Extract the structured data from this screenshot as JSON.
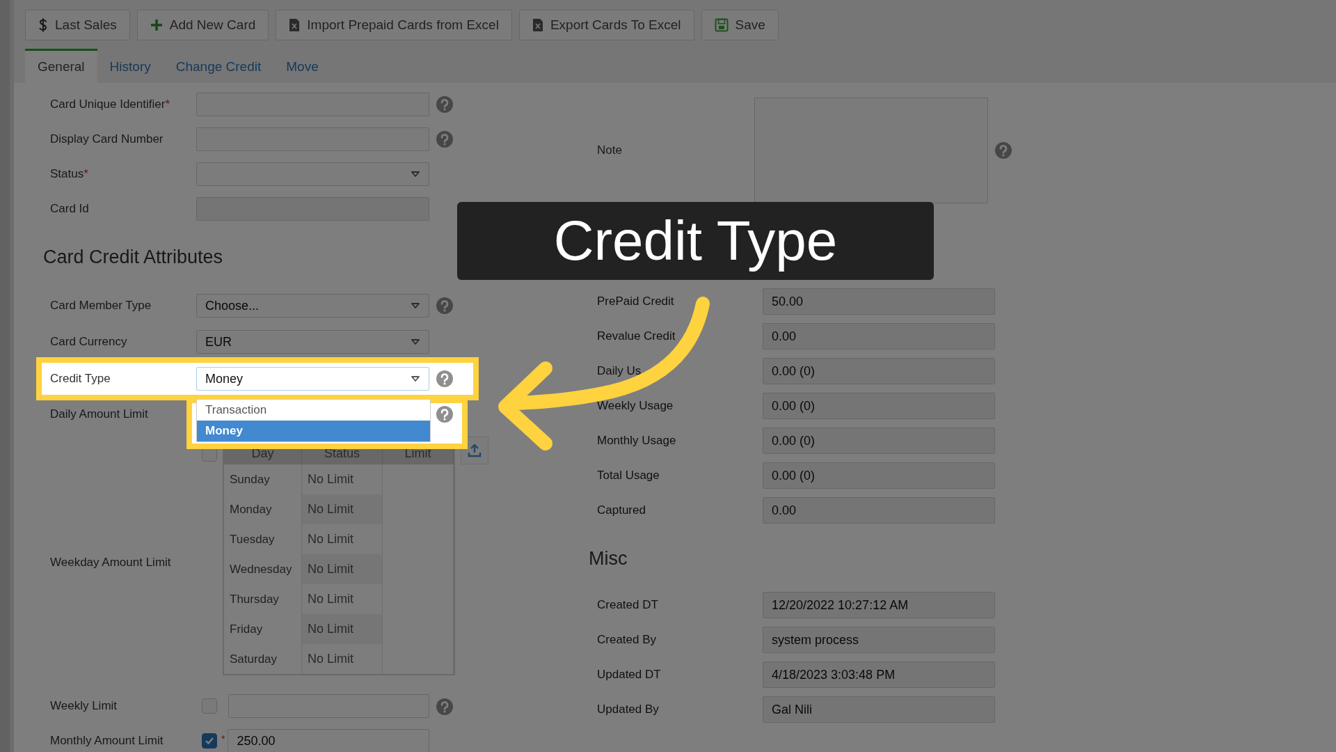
{
  "toolbar": {
    "buttons": [
      {
        "label": "Last Sales"
      },
      {
        "label": "Add New Card"
      },
      {
        "label": "Import Prepaid Cards from Excel"
      },
      {
        "label": "Export Cards To Excel"
      },
      {
        "label": "Save"
      }
    ]
  },
  "tabs": [
    {
      "label": "General",
      "selected": true
    },
    {
      "label": "History",
      "selected": false
    },
    {
      "label": "Change Credit",
      "selected": false
    },
    {
      "label": "Move",
      "selected": false
    }
  ],
  "identity_fields": [
    {
      "label": "Card Unique Identifier",
      "required_mark": "*",
      "kind": "text",
      "help": true
    },
    {
      "label": "Display Card Number",
      "kind": "text",
      "help": true
    },
    {
      "label": "Status",
      "required_mark": "*",
      "kind": "select",
      "help": false
    },
    {
      "label": "Card Id",
      "kind": "readonly",
      "help": false
    }
  ],
  "credit_attributes": {
    "heading": "Card Credit Attributes",
    "selects": [
      {
        "label": "Card Member Type",
        "value": "Choose...",
        "help": true,
        "highlighted": false
      },
      {
        "label": "Card Currency",
        "value": "EUR",
        "help": false,
        "highlighted": false
      },
      {
        "label": "Credit Type",
        "value": "Money",
        "help": true,
        "highlighted": true,
        "options": [
          {
            "label": "Transaction",
            "selected": false
          },
          {
            "label": "Money",
            "selected": true
          }
        ]
      }
    ],
    "daily_amount_limit": {
      "label": "Daily Amount Limit",
      "help": true
    },
    "weekday_amount_limit": {
      "label": "Weekday Amount Limit",
      "enabled": false,
      "columns": [
        "Day",
        "Status",
        "Limit"
      ],
      "rows": [
        {
          "day": "Sunday",
          "status": "No Limit"
        },
        {
          "day": "Monday",
          "status": "No Limit"
        },
        {
          "day": "Tuesday",
          "status": "No Limit"
        },
        {
          "day": "Wednesday",
          "status": "No Limit"
        },
        {
          "day": "Thursday",
          "status": "No Limit"
        },
        {
          "day": "Friday",
          "status": "No Limit"
        },
        {
          "day": "Saturday",
          "status": "No Limit"
        }
      ]
    },
    "weekly_limit": {
      "label": "Weekly Limit",
      "enabled": false,
      "help": true
    },
    "monthly_amount_limit": {
      "label": "Monthly Amount Limit",
      "enabled": true,
      "required_mark": "*",
      "value": "250.00"
    }
  },
  "note": {
    "label": "Note",
    "help": true
  },
  "credit_usage": {
    "rows": [
      {
        "label": "PrePaid Credit",
        "value": "50.00"
      },
      {
        "label": "Revalue Credit",
        "value": "0.00"
      },
      {
        "label": "Daily Us",
        "value": "0.00 (0)"
      },
      {
        "label": "Weekly Usage",
        "value": "0.00 (0)"
      },
      {
        "label": "Monthly Usage",
        "value": "0.00 (0)"
      },
      {
        "label": "Total Usage",
        "value": "0.00 (0)"
      },
      {
        "label": "Captured",
        "value": "0.00"
      }
    ]
  },
  "misc": {
    "heading": "Misc",
    "rows": [
      {
        "label": "Created DT",
        "value": "12/20/2022 10:27:12 AM"
      },
      {
        "label": "Created By",
        "value": "system process"
      },
      {
        "label": "Updated DT",
        "value": "4/18/2023 3:03:48 PM"
      },
      {
        "label": "Updated By",
        "value": "Gal Nili"
      }
    ]
  },
  "callout": {
    "text": "Credit Type"
  }
}
